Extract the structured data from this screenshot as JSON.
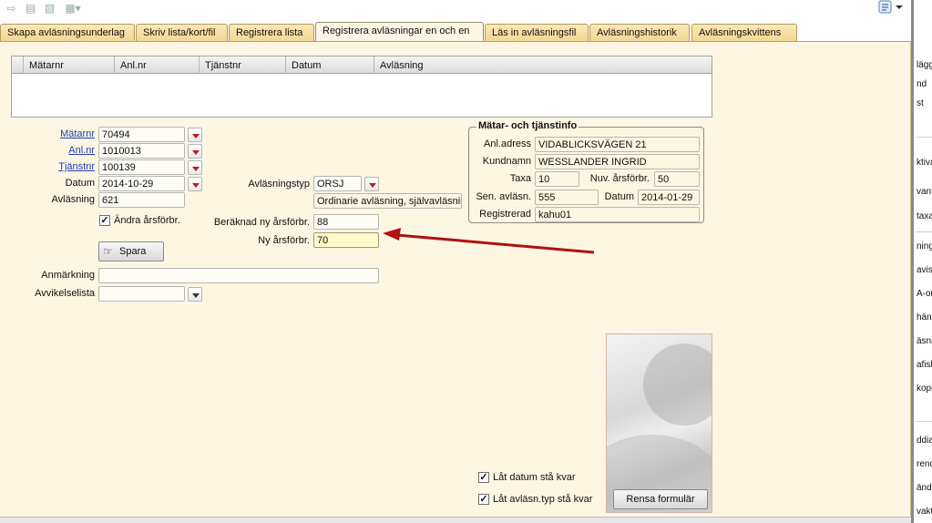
{
  "toolbar": {
    "icons": [
      "open-icon",
      "print-icon",
      "preview-icon",
      "export-icon"
    ],
    "help_icon": "help-icon"
  },
  "tabs": [
    {
      "label": "Skapa avläsningsunderlag"
    },
    {
      "label": "Skriv lista/kort/fil"
    },
    {
      "label": "Registrera lista"
    },
    {
      "label": "Registrera avläsningar en och en",
      "active": true
    },
    {
      "label": "Läs in avläsningsfil"
    },
    {
      "label": "Avläsningshistorik"
    },
    {
      "label": "Avläsningskvittens"
    }
  ],
  "grid": {
    "columns": [
      "Mätarnr",
      "Anl.nr",
      "Tjänstnr",
      "Datum",
      "Avläsning"
    ],
    "rows": []
  },
  "form": {
    "matarnr_label": "Mätarnr",
    "matarnr_value": "70494",
    "anlnr_label": "Anl.nr",
    "anlnr_value": "1010013",
    "tjanstnr_label": "Tjänstnr",
    "tjanstnr_value": "100139",
    "datum_label": "Datum",
    "datum_value": "2014-10-29",
    "avlasning_label": "Avläsning",
    "avlasning_value": "621",
    "avlasningstyp_label": "Avläsningstyp",
    "avlasningstyp_value": "ORSJ",
    "avlasningstyp_desc": "Ordinarie avläsning, självavläsnin",
    "andra_arsforbr_label": "Ändra årsförbr.",
    "andra_arsforbr_checked": true,
    "beraknad_label": "Beräknad ny årsförbr.",
    "beraknad_value": "88",
    "ny_arsforbr_label": "Ny årsförbr.",
    "ny_arsforbr_value": "70",
    "spara_label": "Spara",
    "anmarkning_label": "Anmärkning",
    "anmarkning_value": "",
    "avvikelselista_label": "Avvikelselista",
    "avvikelselista_value": ""
  },
  "info": {
    "title": "Mätar- och tjänstinfo",
    "anladress_label": "Anl.adress",
    "anladress_value": "VIDABLICKSVÄGEN 21",
    "kundnamn_label": "Kundnamn",
    "kundnamn_value": "WESSLANDER INGRID",
    "taxa_label": "Taxa",
    "taxa_value": "10",
    "nuv_label": "Nuv. årsförbr.",
    "nuv_value": "50",
    "sen_label": "Sen. avläsn.",
    "sen_value": "555",
    "sen_datum_label": "Datum",
    "sen_datum_value": "2014-01-29",
    "registrerad_label": "Registrerad",
    "registrerad_value": "kahu01"
  },
  "options": {
    "lat_datum_label": "Låt datum stå kvar",
    "lat_datum_checked": true,
    "lat_avlasn_label": "Låt avläsn.typ stå kvar",
    "lat_avlasn_checked": true,
    "rensa_label": "Rensa formulär"
  },
  "right_panel": {
    "items": [
      "lägg",
      "nd",
      "st",
      "ktiva",
      "vant",
      "taxa",
      "ning",
      "avis",
      "A-ord",
      "händ",
      "äsni",
      "afisk",
      "kopi",
      "ddia",
      "rend",
      "ände",
      "vakt"
    ]
  },
  "colors": {
    "tab_bg": "#f2d592",
    "panel_bg": "#fdf6e3",
    "link": "#1f41b3",
    "arrow": "#b01010",
    "dropdown_arrow": "#c01a1a"
  }
}
